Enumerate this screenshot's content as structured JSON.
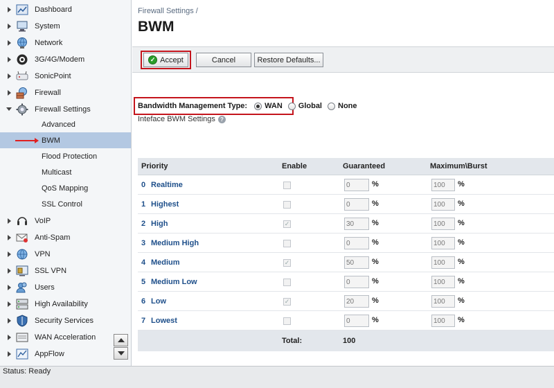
{
  "sidebar": {
    "items": [
      {
        "label": "Dashboard",
        "icon": "dashboard-icon"
      },
      {
        "label": "System",
        "icon": "system-icon"
      },
      {
        "label": "Network",
        "icon": "network-icon"
      },
      {
        "label": "3G/4G/Modem",
        "icon": "modem-icon"
      },
      {
        "label": "SonicPoint",
        "icon": "sonicpoint-icon"
      },
      {
        "label": "Firewall",
        "icon": "firewall-icon"
      },
      {
        "label": "Firewall Settings",
        "icon": "firewall-settings-icon"
      }
    ],
    "subitems": [
      {
        "label": "Advanced"
      },
      {
        "label": "BWM"
      },
      {
        "label": "Flood Protection"
      },
      {
        "label": "Multicast"
      },
      {
        "label": "QoS Mapping"
      },
      {
        "label": "SSL Control"
      }
    ],
    "items_after": [
      {
        "label": "VoIP",
        "icon": "voip-icon"
      },
      {
        "label": "Anti-Spam",
        "icon": "anti-spam-icon"
      },
      {
        "label": "VPN",
        "icon": "vpn-icon"
      },
      {
        "label": "SSL VPN",
        "icon": "ssl-vpn-icon"
      },
      {
        "label": "Users",
        "icon": "users-icon"
      },
      {
        "label": "High Availability",
        "icon": "high-availability-icon"
      },
      {
        "label": "Security Services",
        "icon": "security-services-icon"
      },
      {
        "label": "WAN Acceleration",
        "icon": "wan-acceleration-icon"
      },
      {
        "label": "AppFlow",
        "icon": "appflow-icon"
      }
    ]
  },
  "breadcrumb": "Firewall Settings /",
  "page_title": "BWM",
  "toolbar": {
    "accept_label": "Accept",
    "cancel_label": "Cancel",
    "restore_label": "Restore Defaults..."
  },
  "bwm_type": {
    "label": "Bandwidth Management Type:",
    "options": [
      "WAN",
      "Global",
      "None"
    ],
    "selected": "WAN"
  },
  "iface_settings_label": "Inteface BWM Settings",
  "table": {
    "headers": [
      "Priority",
      "Enable",
      "Guaranteed",
      "Maximum\\Burst"
    ],
    "rows": [
      {
        "num": "0",
        "name": "Realtime",
        "enabled": false,
        "guaranteed": "0",
        "max": "100"
      },
      {
        "num": "1",
        "name": "Highest",
        "enabled": false,
        "guaranteed": "0",
        "max": "100"
      },
      {
        "num": "2",
        "name": "High",
        "enabled": true,
        "guaranteed": "30",
        "max": "100"
      },
      {
        "num": "3",
        "name": "Medium High",
        "enabled": false,
        "guaranteed": "0",
        "max": "100"
      },
      {
        "num": "4",
        "name": "Medium",
        "enabled": true,
        "guaranteed": "50",
        "max": "100"
      },
      {
        "num": "5",
        "name": "Medium Low",
        "enabled": false,
        "guaranteed": "0",
        "max": "100"
      },
      {
        "num": "6",
        "name": "Low",
        "enabled": true,
        "guaranteed": "20",
        "max": "100"
      },
      {
        "num": "7",
        "name": "Lowest",
        "enabled": false,
        "guaranteed": "0",
        "max": "100"
      }
    ],
    "pct": "%",
    "total_label": "Total:",
    "total_value": "100"
  },
  "status": "Status: Ready",
  "colors": {
    "accent_red": "#c4141c",
    "link_blue": "#1e4f8a",
    "selected_bg": "#b3c8e2"
  }
}
